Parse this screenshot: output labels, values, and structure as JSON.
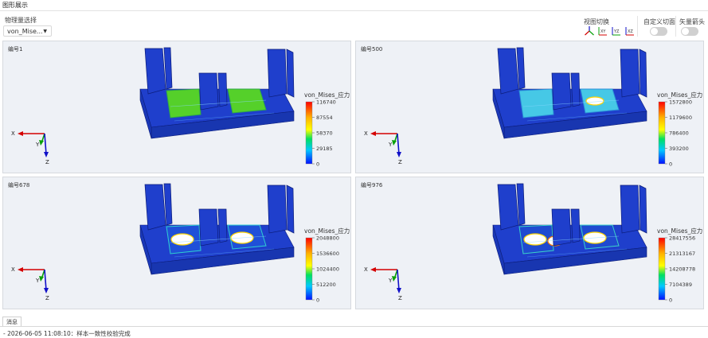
{
  "window": {
    "title": "图形展示"
  },
  "controls": {
    "quantity_label": "物理量选择",
    "quantity_value": "von_Mise...",
    "view_switch_label": "视图切换",
    "view_buttons": [
      {
        "name": "iso",
        "label": ""
      },
      {
        "name": "xy",
        "label": "XY"
      },
      {
        "name": "yz",
        "label": "YZ"
      },
      {
        "name": "xz",
        "label": "XZ"
      }
    ],
    "custom_section_label": "自定义切面",
    "vector_arrow_label": "矢量箭头",
    "custom_section_on": false,
    "vector_arrow_on": false
  },
  "panels": [
    {
      "label": "编号1",
      "legend_title": "von_Mises_应力",
      "ticks": [
        "116740",
        "87554",
        "58370",
        "29185",
        "0"
      ],
      "state": "sample1"
    },
    {
      "label": "编号500",
      "legend_title": "von_Mises_应力",
      "ticks": [
        "1572800",
        "1179600",
        "786400",
        "393200",
        "0"
      ],
      "state": "sample500"
    },
    {
      "label": "编号678",
      "legend_title": "von_Mises_应力",
      "ticks": [
        "2048800",
        "1536600",
        "1024400",
        "512200",
        "0"
      ],
      "state": "sample678"
    },
    {
      "label": "编号976",
      "legend_title": "von_Mises_应力",
      "ticks": [
        "28417556",
        "21313167",
        "14208778",
        "7104389",
        "0"
      ],
      "state": "sample976"
    }
  ],
  "axes": {
    "x": "X",
    "y": "Y",
    "z": "Z"
  },
  "colors": {
    "part_blue": "#1f3fcc",
    "panel_bg": "#eef1f6",
    "axis_x": "#d40000",
    "axis_y": "#0aa00a",
    "axis_z": "#1010c8"
  },
  "messages": {
    "tab_label": "消息",
    "lines": [
      "- 2026-06-05 11:08:10：样本一致性校验完成"
    ]
  }
}
